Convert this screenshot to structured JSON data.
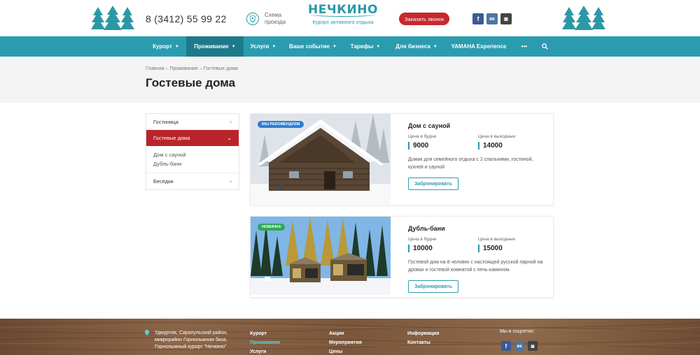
{
  "header": {
    "phone": "8 (3412) 55 99 22",
    "map_label": "Схема проезда",
    "logo_name": "НЕЧКИНО",
    "logo_subtitle": "Курорт активного отдыха",
    "callback_label": "Заказать звонок",
    "social": [
      {
        "icon": "facebook-icon",
        "glyph": "f",
        "color": "#3b5998"
      },
      {
        "icon": "vk-icon",
        "glyph": "вк",
        "color": "#4c75a3"
      },
      {
        "icon": "instagram-icon",
        "glyph": "◙",
        "color": "#444444"
      }
    ]
  },
  "nav": {
    "items": [
      {
        "label": "Курорт",
        "caret": true,
        "active": false
      },
      {
        "label": "Проживание",
        "caret": true,
        "active": true
      },
      {
        "label": "Услуги",
        "caret": true,
        "active": false
      },
      {
        "label": "Ваше событие",
        "caret": true,
        "active": false
      },
      {
        "label": "Тарифы",
        "caret": true,
        "active": false
      },
      {
        "label": "Для бизнеса",
        "caret": true,
        "active": false
      },
      {
        "label": "YAMAHA Experience",
        "caret": false,
        "active": false
      },
      {
        "label": "•••",
        "caret": false,
        "active": false
      }
    ],
    "search_icon": "search-icon"
  },
  "breadcrumb": [
    "Главная",
    "Проживание",
    "Гостевые дома"
  ],
  "page_title": "Гостевые дома",
  "sidebar": {
    "items": [
      {
        "label": "Гостиница",
        "active": false
      },
      {
        "label": "Гостевые дома",
        "active": true
      },
      {
        "label": "Беседки",
        "active": false
      }
    ],
    "subitems": [
      "Дом с сауной",
      "Дубль-бани"
    ]
  },
  "cards": [
    {
      "badge": "МЫ РЕКОМЕНДУЕМ",
      "badge_color": "#2f7fd1",
      "title": "Дом с сауной",
      "weekday_label": "Цена в будни",
      "weekday_price": "9000",
      "weekend_label": "Цена в выходные",
      "weekend_price": "14000",
      "description": "Домик для семейного отдыха с 2 спальнями, гостиной, кухней и сауной",
      "button": "Забронировать"
    },
    {
      "badge": "НОВИНКА",
      "badge_color": "#2ea85a",
      "title": "Дубль-бани",
      "weekday_label": "Цена в будни",
      "weekday_price": "10000",
      "weekend_label": "Цена в выходные",
      "weekend_price": "15000",
      "description": "Гостевой дом на 8 человек с настоящей русской парной на дровах и гостевой комнатой с печь-камином.",
      "button": "Забронировать"
    }
  ],
  "footer": {
    "address": "Удмуртия, Сарапульский район, микрорайон Горнолыжная база, Горнолыжный курорт \"Нечкино\"",
    "col1": [
      "Курорт",
      "Проживание",
      "Услуги"
    ],
    "col2": [
      "Акции",
      "Мероприятия",
      "Цены"
    ],
    "col3": [
      "Информация",
      "Контакты"
    ],
    "social_title": "Мы в соцсетях:",
    "social": [
      {
        "icon": "facebook-icon",
        "glyph": "f",
        "color": "#3b5998"
      },
      {
        "icon": "vk-icon",
        "glyph": "вк",
        "color": "#4c75a3"
      },
      {
        "icon": "instagram-icon",
        "glyph": "◙",
        "color": "#444444"
      }
    ]
  }
}
